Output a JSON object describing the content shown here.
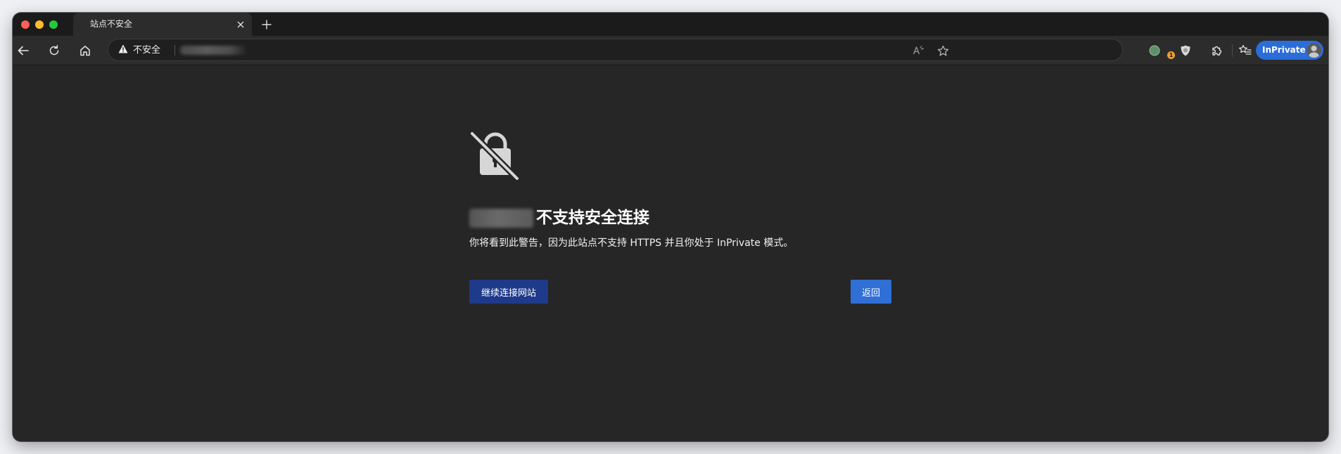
{
  "tab": {
    "title": "站点不安全"
  },
  "omnibox": {
    "security_label": "不安全"
  },
  "toolbar": {
    "extension_badge_count": "1",
    "inprivate_label": "InPrivate"
  },
  "page": {
    "heading_suffix": "不支持安全连接",
    "description": "你将看到此警告，因为此站点不支持 HTTPS 并且你处于 InPrivate 模式。",
    "continue_button": "继续连接网站",
    "back_button": "返回"
  }
}
